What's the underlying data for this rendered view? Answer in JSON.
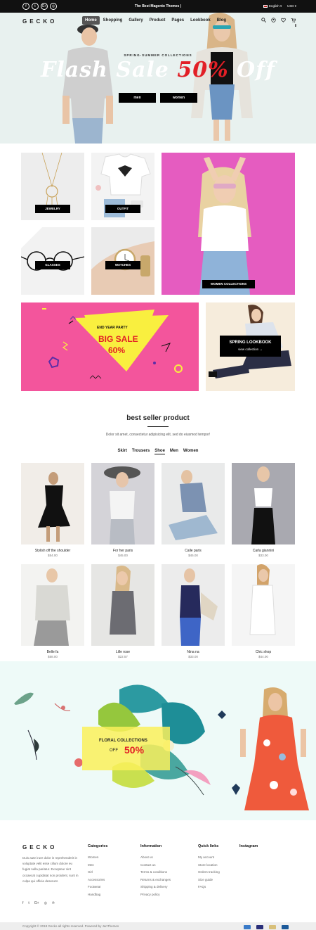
{
  "topbar": {
    "socials": [
      "f",
      "t",
      "G+",
      "◎"
    ],
    "promo": "The Best Magento Themes",
    "language": "English ▾",
    "currency": "USD ▾"
  },
  "header": {
    "logo": "GECKO",
    "menu": [
      "Home",
      "Shopping",
      "Gallery",
      "Product",
      "Pages",
      "Lookbook",
      "Blog"
    ],
    "cart_count": "0"
  },
  "hero": {
    "subtitle": "SPRING-SUMMER COLLECTIONS",
    "title_main": "Flash Sale ",
    "title_red": "50%",
    "title_end": " Off",
    "btn_men": "men",
    "btn_women": "women"
  },
  "categories": {
    "jewelry": "JEWELRY",
    "outfit": "OUTFIT",
    "glasses": "GLASSES",
    "watches": "WATCHES",
    "women": "WOMEN COLLECTIONS"
  },
  "banner_sale": {
    "label": "END YEAR PARTY",
    "title": "BIG SALE",
    "percent": "60%"
  },
  "banner_lookbook": {
    "title": "SPRING LOOKBOOK",
    "link": "view collection →"
  },
  "best_seller": {
    "title": "best seller product",
    "subtitle": "Dolor sit amet, consectetur adipisicing elit, sed do eiusmod tempor!",
    "tabs": [
      "Skirt",
      "Trousers",
      "Shoe",
      "Men",
      "Women"
    ],
    "active_tab": "Shoe",
    "products": [
      {
        "name": "Stylish off the shoulder",
        "price": "$54.00"
      },
      {
        "name": "For her paris",
        "price": "$45.00"
      },
      {
        "name": "Calle paris",
        "price": "$45.00"
      },
      {
        "name": "Carla giannini",
        "price": "$33.00"
      },
      {
        "name": "Belle fa",
        "price": "$58.00"
      },
      {
        "name": "Lille rose",
        "price": "$22.57"
      },
      {
        "name": "Nina na",
        "price": "$33.00"
      },
      {
        "name": "Chic shop",
        "price": "$44.00"
      }
    ]
  },
  "floral": {
    "title": "FLORAL COLLECTIONS",
    "off": "OFF",
    "percent": "50%"
  },
  "footer": {
    "logo": "GECKO",
    "about": "Duis aute irure dolor in reprehenderit in voluptate velit esse cillum dolore eu fugiat nulla pariatur. Excepteur sint occaecat cupidatat non proident, sunt in culpa qui officia deserunt.",
    "social": [
      "f",
      "t",
      "G+",
      "◎",
      "℗"
    ],
    "categories_title": "Categories",
    "categories": [
      "Women",
      "Men",
      "Girl",
      "Accessories",
      "Footwear",
      "Handbag"
    ],
    "information_title": "Information",
    "information": [
      "About us",
      "Contact us",
      "Terms & conditions",
      "Returns & exchanges",
      "Shipping & delivery",
      "Privacy policy"
    ],
    "quicklinks_title": "Quick links",
    "quicklinks": [
      "My account",
      "Store location",
      "Orders tracking",
      "Size guide",
      "FAQs"
    ],
    "instagram_title": "Instagram",
    "copyright": "Copyright © 2018 Gecko all rights reserved. Powered by JanThemes"
  },
  "colors": {
    "accent_red": "#e21f26",
    "pink": "#f3559c",
    "yellow": "#fff25c"
  }
}
